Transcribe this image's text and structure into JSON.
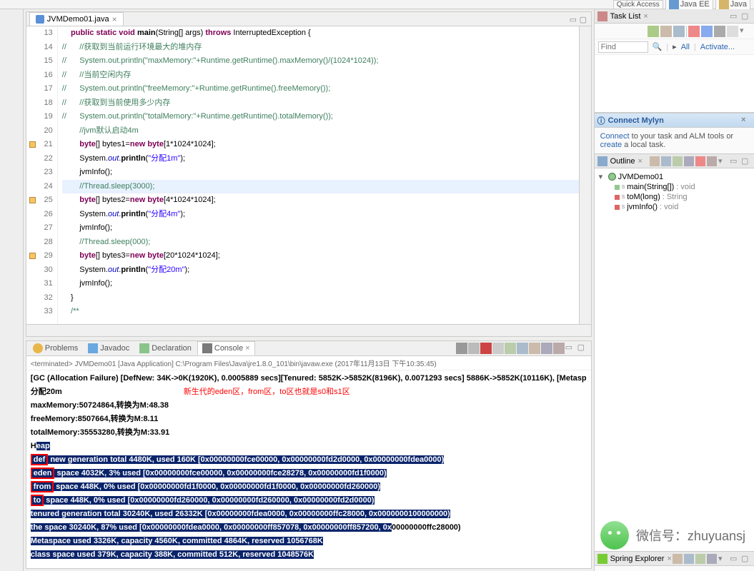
{
  "topbar": {
    "quick_access": "Quick Access",
    "perspective_javaee": "Java EE",
    "perspective_java": "Java"
  },
  "editor": {
    "tab_label": "JVMDemo01.java",
    "lines": [
      {
        "n": 13,
        "html": "    <span class='kw'>public static void</span> <span class='mth'>main</span>(String[] args) <span class='kw'>throws</span> InterruptedException {"
      },
      {
        "n": 14,
        "html": "<span class='cmt'>//      //获取到当前运行环境最大的堆内存</span>"
      },
      {
        "n": 15,
        "html": "<span class='cmt'>//      System.out.println(\"maxMemory:\"+Runtime.getRuntime().maxMemory()/(1024*1024));</span>"
      },
      {
        "n": 16,
        "html": "<span class='cmt'>//      //当前空闲内存</span>"
      },
      {
        "n": 17,
        "html": "<span class='cmt'>//      System.out.println(\"freeMemory:\"+Runtime.getRuntime().freeMemory());</span>"
      },
      {
        "n": 18,
        "html": "<span class='cmt'>//      //获取到当前使用多少内存</span>"
      },
      {
        "n": 19,
        "html": "<span class='cmt'>//      System.out.println(\"totalMemory:\"+Runtime.getRuntime().totalMemory());</span>"
      },
      {
        "n": 20,
        "html": "        <span class='cmt'>//jvm默认启动4m</span>"
      },
      {
        "n": 21,
        "mark": true,
        "html": "        <span class='kw'>byte</span>[] bytes1=<span class='kw'>new byte</span>[1*1024*1024];"
      },
      {
        "n": 22,
        "html": "        System.<span class='fld'>out</span>.<span class='mth'>println</span>(<span class='str'>\"分配1m\"</span>);"
      },
      {
        "n": 23,
        "html": "        jvmInfo();"
      },
      {
        "n": 24,
        "cur": true,
        "html": "        <span class='cmt'>//Thread.sleep(3000);</span>"
      },
      {
        "n": 25,
        "mark": true,
        "html": "        <span class='kw'>byte</span>[] bytes2=<span class='kw'>new byte</span>[4*1024*1024];"
      },
      {
        "n": 26,
        "html": "        System.<span class='fld'>out</span>.<span class='mth'>println</span>(<span class='str'>\"分配4m\"</span>);"
      },
      {
        "n": 27,
        "html": "        jvmInfo();"
      },
      {
        "n": 28,
        "html": "        <span class='cmt'>//Thread.sleep(000);</span>"
      },
      {
        "n": 29,
        "mark": true,
        "html": "        <span class='kw'>byte</span>[] bytes3=<span class='kw'>new byte</span>[20*1024*1024];"
      },
      {
        "n": 30,
        "html": "        System.<span class='fld'>out</span>.<span class='mth'>println</span>(<span class='str'>\"分配20m\"</span>);"
      },
      {
        "n": 31,
        "html": "        jvmInfo();"
      },
      {
        "n": 32,
        "html": "    }"
      },
      {
        "n": 33,
        "html": "    <span class='cmt'>/**</span>"
      }
    ]
  },
  "console": {
    "tabs": {
      "problems": "Problems",
      "javadoc": "Javadoc",
      "declaration": "Declaration",
      "console": "Console"
    },
    "status": "<terminated> JVMDemo01 [Java Application] C:\\Program Files\\Java\\jre1.8.0_101\\bin\\javaw.exe (2017年11月13日 下午10:35:45)",
    "line_gc": "[GC (Allocation Failure) [DefNew: 34K->0K(1920K), 0.0005889 secs][Tenured: 5852K->5852K(8196K), 0.0071293 secs] 5886K->5852K(10116K), [Metasp",
    "line_alloc": "分配20m",
    "annotation": "新生代的eden区，from区，to区也就是s0和s1区",
    "line_max": "maxMemory:50724864,转换为M:48.38",
    "line_free": "freeMemory:8507664,转换为M:8.11",
    "line_total": "totalMemory:35553280,转换为M:33.91",
    "heap_h": "H",
    "heap_eap": "eap",
    "def_label": "def",
    "def_rest": " new generation   total 4480K, used 160K [0x00000000fce00000, 0x00000000fd2d0000, 0x00000000fdea0000)",
    "eden_label": "eden",
    "eden_rest": " space 4032K,   3% used [0x00000000fce00000, 0x00000000fce28278, 0x00000000fd1f0000)",
    "from_label": "from",
    "from_rest": " space 448K,   0% used [0x00000000fd1f0000, 0x00000000fd1f0000, 0x00000000fd260000)",
    "to_label": "to",
    "to_rest": "   space 448K,   0% used [0x00000000fd260000, 0x00000000fd260000, 0x00000000fd2d0000)",
    "tenured": " tenured generation   total 30240K, used 26332K [0x00000000fdea0000, 0x00000000ffc28000, 0x0000000100000000)",
    "tenured_space": "   the space 30240K,  87% used [0x00000000fdea0000, 0x00000000ff857078, 0x00000000ff857200, 0x",
    "tenured_space_unsel": "00000000ffc28000)",
    "metaspace": " Metaspace       used 3326K, capacity 4560K, committed 4864K, reserved 1056768K",
    "classspace": "  class space    used 379K, capacity 388K, committed 512K, reserved 1048576K"
  },
  "tasklist": {
    "title": "Task List",
    "find_placeholder": "Find",
    "all": "All",
    "activate": "Activate..."
  },
  "mylyn": {
    "title": "Connect Mylyn",
    "text_pre": "Connect",
    "text_mid": " to your task and ALM tools or ",
    "text_link2": "create",
    "text_post": " a local task."
  },
  "outline": {
    "title": "Outline",
    "class_name": "JVMDemo01",
    "methods": [
      {
        "name": "main(String[])",
        "type": ": void",
        "sicon": "green"
      },
      {
        "name": "toM(long)",
        "type": ": String",
        "sicon": "red"
      },
      {
        "name": "jvmInfo()",
        "type": ": void",
        "sicon": "red"
      }
    ]
  },
  "springexp": {
    "title": "Spring Explorer"
  },
  "watermark": {
    "text": "微信号：zhuyuansj"
  }
}
